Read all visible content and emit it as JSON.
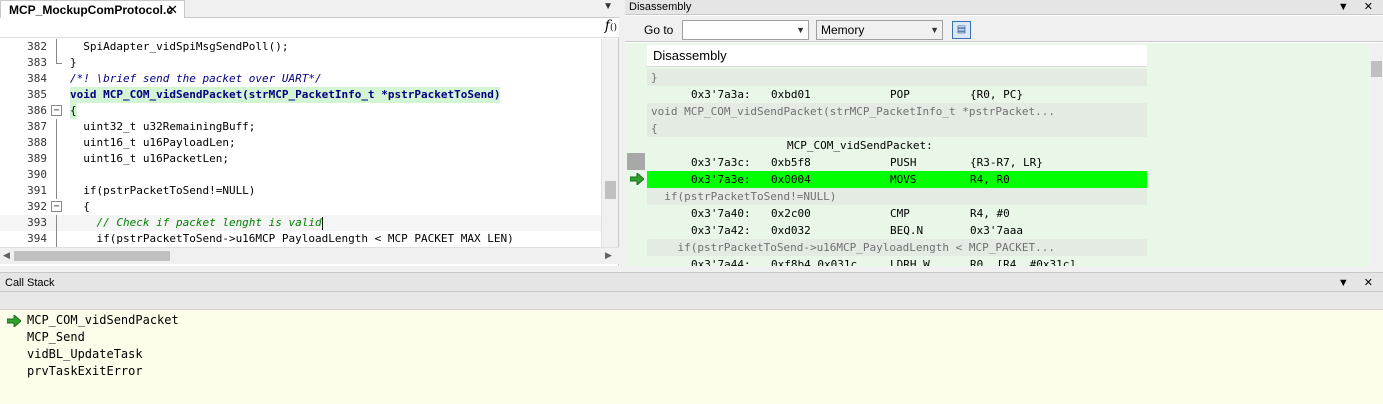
{
  "editor": {
    "tab_title": "MCP_MockupComProtocol.c",
    "close_glyph": "✕",
    "dropdown_glyph": "▼",
    "func_icon": "f",
    "func_icon_sub": "()",
    "lines": [
      {
        "num": "382",
        "text": "  SpiAdapter_vidSpiMsgSendPoll();"
      },
      {
        "num": "383",
        "text": "}"
      },
      {
        "num": "384",
        "text": "/*! \\brief send the packet over UART*/"
      },
      {
        "num": "385",
        "text": "void MCP_COM_vidSendPacket(strMCP_PacketInfo_t *pstrPacketToSend)"
      },
      {
        "num": "386",
        "text": "{"
      },
      {
        "num": "387",
        "text": "  uint32_t u32RemainingBuff;"
      },
      {
        "num": "388",
        "text": "  uint16_t u16PayloadLen;"
      },
      {
        "num": "389",
        "text": "  uint16_t u16PacketLen;"
      },
      {
        "num": "390",
        "text": ""
      },
      {
        "num": "391",
        "text": "  if(pstrPacketToSend!=NULL)"
      },
      {
        "num": "392",
        "text": "  {"
      },
      {
        "num": "393",
        "text": "    // Check if packet lenght is valid"
      },
      {
        "num": "394",
        "text": "    if(pstrPacketToSend->u16MCP PayloadLength < MCP PACKET MAX LEN)"
      }
    ]
  },
  "disassembly": {
    "title": "Disassembly",
    "goto_label": "Go to",
    "goto_value": "",
    "memory_label": "Memory",
    "header": "Disassembly",
    "rows": [
      {
        "kind": "src",
        "text": "}"
      },
      {
        "kind": "ins",
        "addr": "0x3'7a3a:",
        "op": "0xbd01",
        "mnem": "POP",
        "args": "{R0, PC}"
      },
      {
        "kind": "src",
        "text": "void MCP_COM_vidSendPacket(strMCP_PacketInfo_t *pstrPacket..."
      },
      {
        "kind": "src",
        "text": "{"
      },
      {
        "kind": "lbl",
        "text": "MCP_COM_vidSendPacket:"
      },
      {
        "kind": "ins",
        "addr": "0x3'7a3c:",
        "op": "0xb5f8",
        "mnem": "PUSH",
        "args": "{R3-R7, LR}"
      },
      {
        "kind": "active",
        "addr": "0x3'7a3e:",
        "op": "0x0004",
        "mnem": "MOVS",
        "args": "R4, R0"
      },
      {
        "kind": "src",
        "text": "  if(pstrPacketToSend!=NULL)"
      },
      {
        "kind": "ins",
        "addr": "0x3'7a40:",
        "op": "0x2c00",
        "mnem": "CMP",
        "args": "R4, #0"
      },
      {
        "kind": "ins",
        "addr": "0x3'7a42:",
        "op": "0xd032",
        "mnem": "BEQ.N",
        "args": "0x3'7aaa"
      },
      {
        "kind": "src",
        "text": "    if(pstrPacketToSend->u16MCP_PayloadLength < MCP_PACKET..."
      },
      {
        "kind": "ins",
        "addr": "0x3'7a44:",
        "op": "0xf8b4 0x031c",
        "mnem": "LDRH.W",
        "args": "R0, [R4, #0x31c]"
      }
    ]
  },
  "callstack": {
    "title": "Call Stack",
    "frames": [
      "MCP_COM_vidSendPacket",
      "MCP_Send",
      "vidBL_UpdateTask",
      "prvTaskExitError"
    ]
  },
  "pane_controls": "▼ ✕",
  "colors": {
    "active_line": "#00ff00",
    "arrow": "#2ea12e",
    "comment": "#008000",
    "callstack_bg": "#fdfdea"
  }
}
